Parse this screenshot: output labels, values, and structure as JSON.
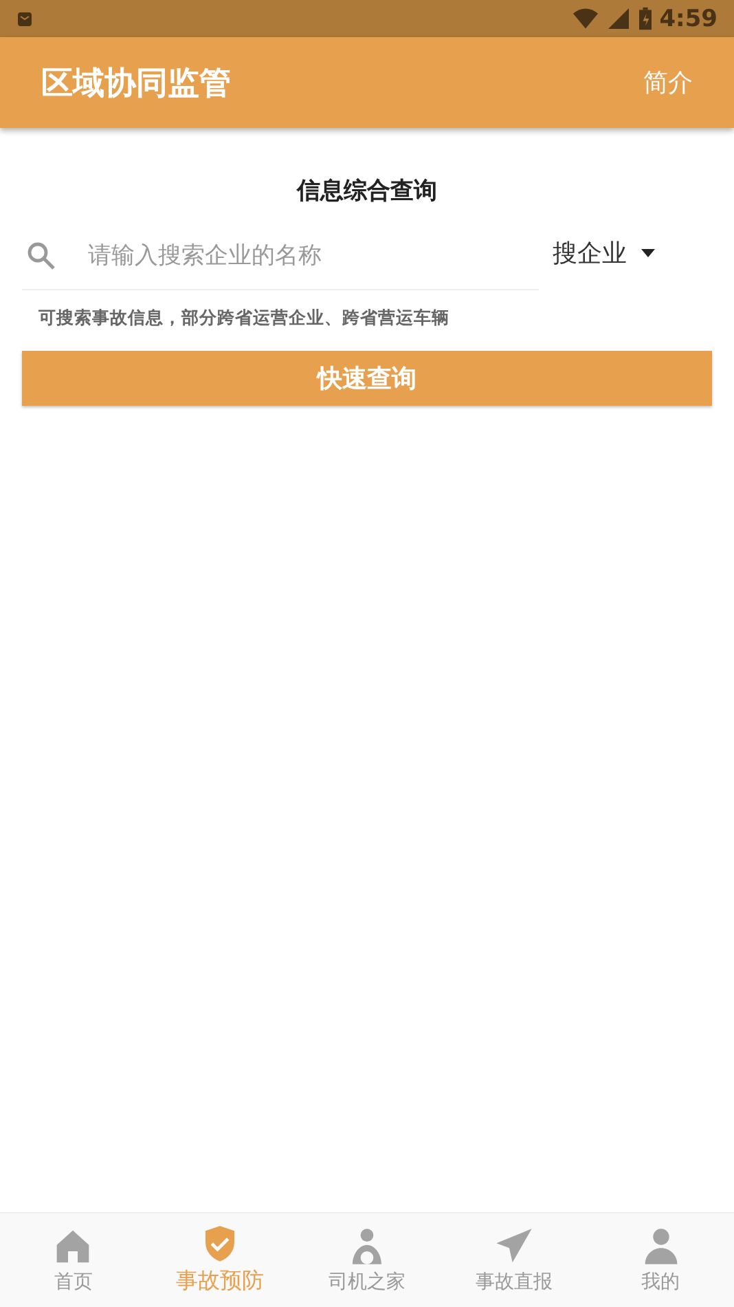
{
  "status_bar": {
    "time": "4:59"
  },
  "app_bar": {
    "title": "区域协同监管",
    "action": "简介"
  },
  "search": {
    "heading": "信息综合查询",
    "placeholder": "请输入搜索企业的名称",
    "scope": "搜企业",
    "hint": "可搜索事故信息，部分跨省运营企业、跨省营运车辆",
    "button": "快速查询"
  },
  "tabs": [
    {
      "label": "首页",
      "kind": "home",
      "selected": false
    },
    {
      "label": "事故预防",
      "kind": "shield",
      "selected": true
    },
    {
      "label": "司机之家",
      "kind": "driver",
      "selected": false
    },
    {
      "label": "事故直报",
      "kind": "send",
      "selected": false
    },
    {
      "label": "我的",
      "kind": "person",
      "selected": false
    }
  ]
}
